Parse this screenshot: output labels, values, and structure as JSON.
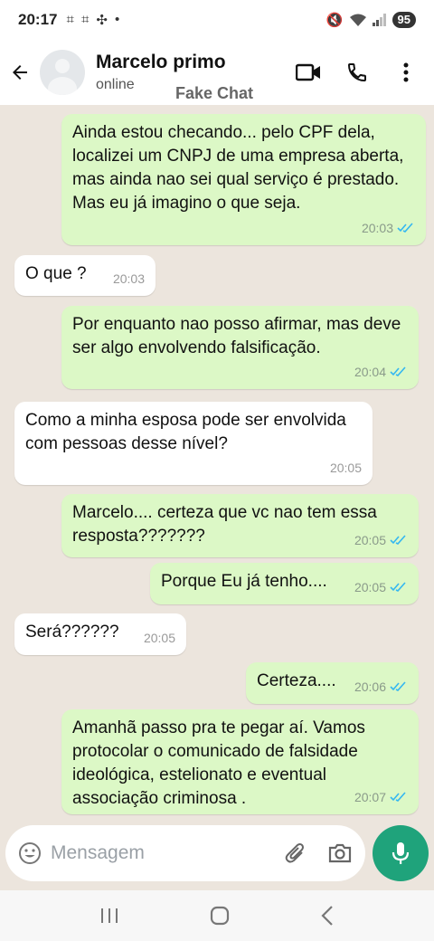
{
  "status_bar": {
    "time": "20:17",
    "battery": "95"
  },
  "header": {
    "contact_name": "Marcelo primo",
    "contact_status": "online",
    "watermark": "Fake Chat"
  },
  "messages": [
    {
      "dir": "out",
      "text": "Ainda estou checando... pelo CPF dela, localizei um CNPJ de uma empresa aberta, mas ainda nao sei qual serviço é prestado. Mas eu já imagino o que seja.",
      "time": "20:03"
    },
    {
      "dir": "in",
      "text": "O que ?",
      "time": "20:03"
    },
    {
      "dir": "out",
      "text": "Por enquanto nao posso afirmar, mas deve ser algo envolvendo falsificação.",
      "time": "20:04"
    },
    {
      "dir": "in",
      "text": "Como a minha esposa pode ser envolvida com pessoas desse nível?",
      "time": "20:05"
    },
    {
      "dir": "out",
      "text": "Marcelo.... certeza que vc nao tem essa resposta???????",
      "time": "20:05"
    },
    {
      "dir": "out",
      "text": "Porque Eu já tenho....",
      "time": "20:05"
    },
    {
      "dir": "in",
      "text": "Será??????",
      "time": "20:05"
    },
    {
      "dir": "out",
      "text": "Certeza....",
      "time": "20:06"
    },
    {
      "dir": "out",
      "text": "Amanhã passo pra te pegar aí. Vamos protocolar o comunicado de falsidade ideológica, estelionato e eventual associação criminosa .",
      "time": "20:07"
    }
  ],
  "input": {
    "placeholder": "Mensagem"
  },
  "colors": {
    "outgoing": "#dcf8c6",
    "incoming": "#ffffff",
    "accent": "#1fa37b",
    "read_ticks": "#34b7f1"
  }
}
